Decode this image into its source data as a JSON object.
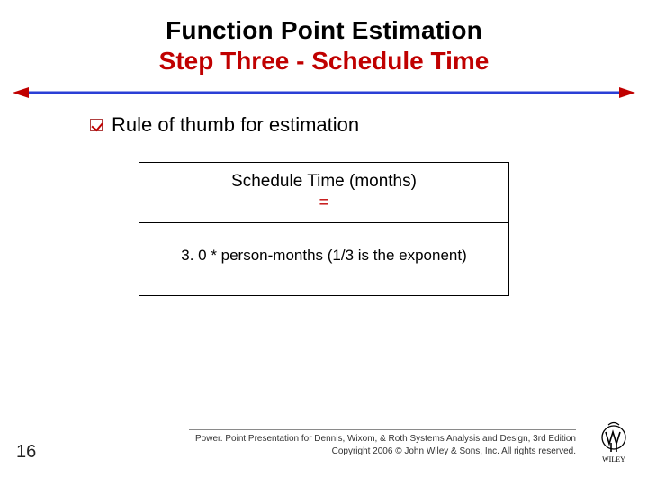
{
  "title": {
    "line1": "Function Point Estimation",
    "line2": "Step Three - Schedule Time"
  },
  "bullet": {
    "text": "Rule of thumb for estimation"
  },
  "formula": {
    "header_line1": "Schedule Time (months)",
    "header_eq": "=",
    "body": "3. 0 * person-months (1/3 is the exponent)"
  },
  "footer": {
    "line1": "Power. Point Presentation for Dennis, Wixom, & Roth Systems Analysis and Design, 3rd Edition",
    "line2": "Copyright 2006 © John Wiley & Sons, Inc.  All rights reserved."
  },
  "page_number": "16",
  "publisher": "WILEY",
  "colors": {
    "accent": "#c00000",
    "rule_blue": "#2a3fd6"
  }
}
